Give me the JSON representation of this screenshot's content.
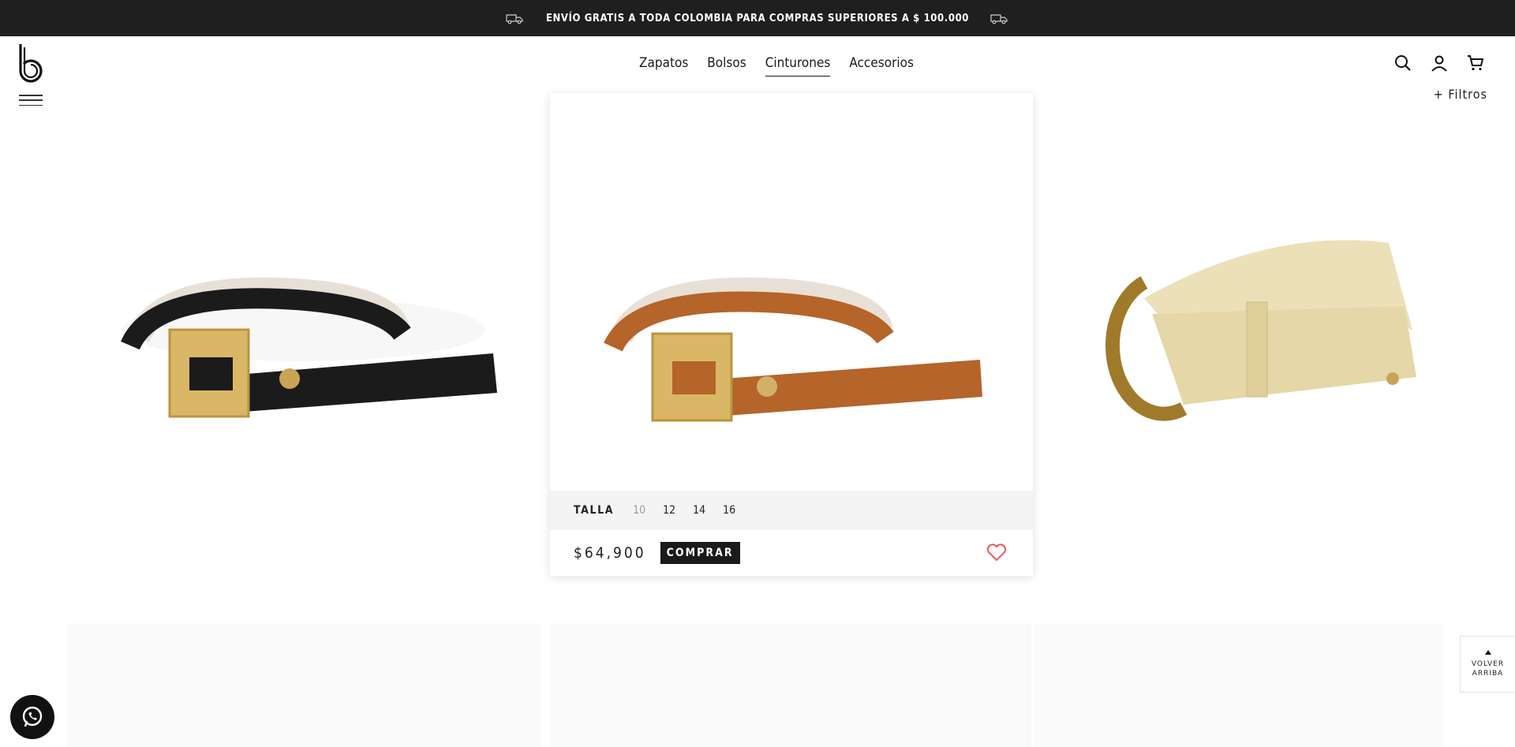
{
  "promo": {
    "text": "ENVÍO GRATIS A TODA COLOMBIA PARA COMPRAS SUPERIORES A $ 100.000"
  },
  "header": {
    "nav": [
      {
        "label": "Zapatos",
        "active": false
      },
      {
        "label": "Bolsos",
        "active": false
      },
      {
        "label": "Cinturones",
        "active": true
      },
      {
        "label": "Accesorios",
        "active": false
      }
    ]
  },
  "filters": {
    "label": "+ Filtros"
  },
  "products": [
    {
      "color": "#1b1b1b",
      "buckle": "gold-square"
    },
    {
      "color": "#b5642a",
      "buckle": "gold-square"
    },
    {
      "color": "#e6d7a8",
      "buckle": "gold-horseshoe"
    }
  ],
  "card": {
    "size_label": "TALLA",
    "sizes": [
      {
        "label": "10",
        "available": false
      },
      {
        "label": "12",
        "available": true
      },
      {
        "label": "14",
        "available": true
      },
      {
        "label": "16",
        "available": true
      }
    ],
    "price": "$64,900",
    "buy_label": "COMPRAR"
  },
  "back_to_top": {
    "line1": "VOLVER",
    "line2": "ARRIBA"
  },
  "colors": {
    "promo_bg": "#1f1f1f",
    "heart": "#e85a5a"
  }
}
